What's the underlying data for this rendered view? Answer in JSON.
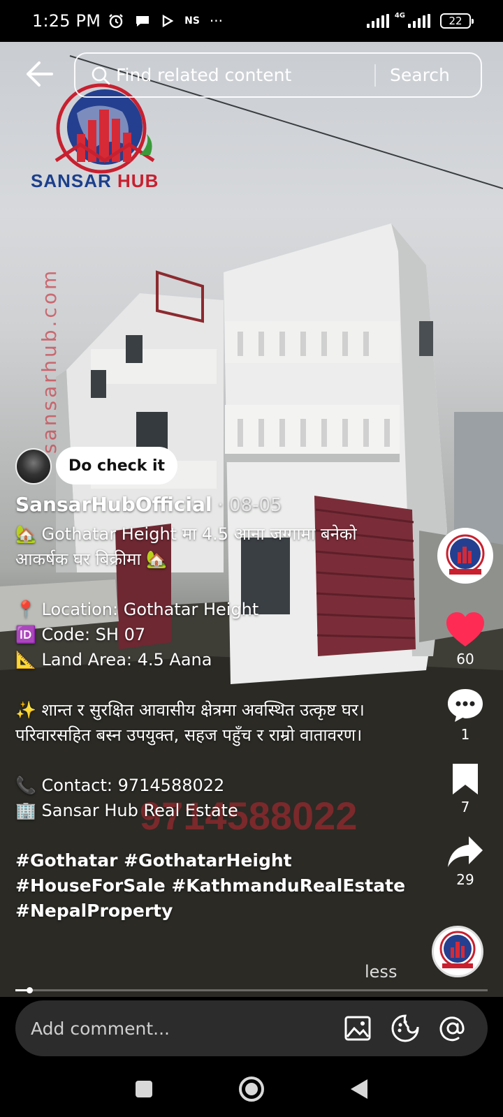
{
  "status_bar": {
    "time": "1:25 PM",
    "network_label": "NS",
    "more_label": "···",
    "network_type": "4G",
    "battery_level": "22"
  },
  "search": {
    "placeholder": "Find related content",
    "button_label": "Search"
  },
  "logo": {
    "brand_part1": "SANSAR",
    "brand_part2": "HUB",
    "vertical_url": "sansarhub.com"
  },
  "comment_bubble": {
    "text": "Do check it"
  },
  "post": {
    "author": "SansarHubOfficial",
    "date": "· 08-05",
    "lines": [
      "🏡 Gothatar Height मा 4.5 आना जग्गामा बनेको आकर्षक घर बिक्रीमा 🏡",
      "📍 Location: Gothatar Height",
      "🆔 Code: SH 07",
      "📐 Land Area: 4.5 Aana",
      "✨ शान्त र सुरक्षित आवासीय क्षेत्रमा अवस्थित उत्कृष्ट घर। परिवारसहित बस्न उपयुक्त, सहज पहुँच र राम्रो वातावरण।",
      "📞 Contact: 9714588022",
      "🏢 Sansar Hub Real Estate"
    ],
    "hashtags": "#Gothatar #GothatarHeight #HouseForSale #KathmanduRealEstate #NepalProperty",
    "less_label": "less",
    "watermark_phone": "9714588022"
  },
  "actions": {
    "likes": "60",
    "comments": "1",
    "saves": "7",
    "shares": "29",
    "like_color": "#fe2c55"
  },
  "progress": {
    "fraction": 0.03
  },
  "comment_input": {
    "placeholder": "Add comment..."
  },
  "icons": {
    "back": "back-arrow-icon",
    "search": "search-icon",
    "like": "heart-icon",
    "comment": "comment-icon",
    "save": "bookmark-icon",
    "share": "share-icon",
    "image": "image-icon",
    "emoji": "sticker-icon",
    "mention": "at-icon"
  }
}
